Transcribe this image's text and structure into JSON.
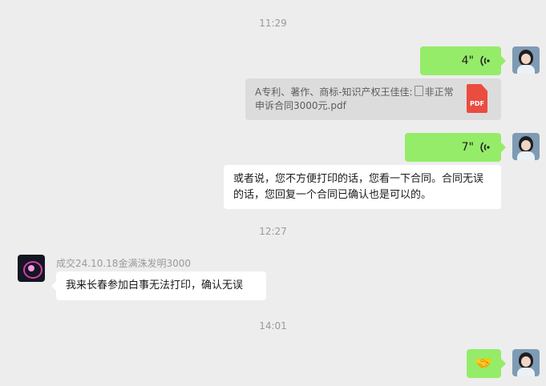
{
  "colors": {
    "background": "#ededed",
    "self_bubble": "#95ec69",
    "other_bubble": "#ffffff",
    "file_card": "#dcdcdc",
    "pdf_badge": "#ea4c3f"
  },
  "timestamps": [
    "11:29",
    "12:27",
    "14:01"
  ],
  "messages": [
    {
      "type": "voice",
      "from": "self",
      "duration": "4\"",
      "icon": "voice-wave-icon"
    },
    {
      "type": "file",
      "from": "self",
      "text_prefix": "A专利、著作、商标-知识产权王佳佳:",
      "text_suffix": "非正常申诉合同3000元.pdf",
      "badge": "PDF",
      "icon": "pdf-file-icon"
    },
    {
      "type": "voice",
      "from": "self",
      "duration": "7\"",
      "icon": "voice-wave-icon"
    },
    {
      "type": "text",
      "from": "self",
      "text": "或者说，您不方便打印的话，您看一下合同。合同无误的话，您回复一个合同已确认也是可以的。"
    },
    {
      "type": "text",
      "from": "other",
      "sender": "成交24.10.18金满洙发明3000",
      "text": "我来长春参加白事无法打印，确认无误"
    },
    {
      "type": "emoji",
      "from": "self",
      "emoji": "🤝",
      "icon": "handshake-icon"
    }
  ]
}
